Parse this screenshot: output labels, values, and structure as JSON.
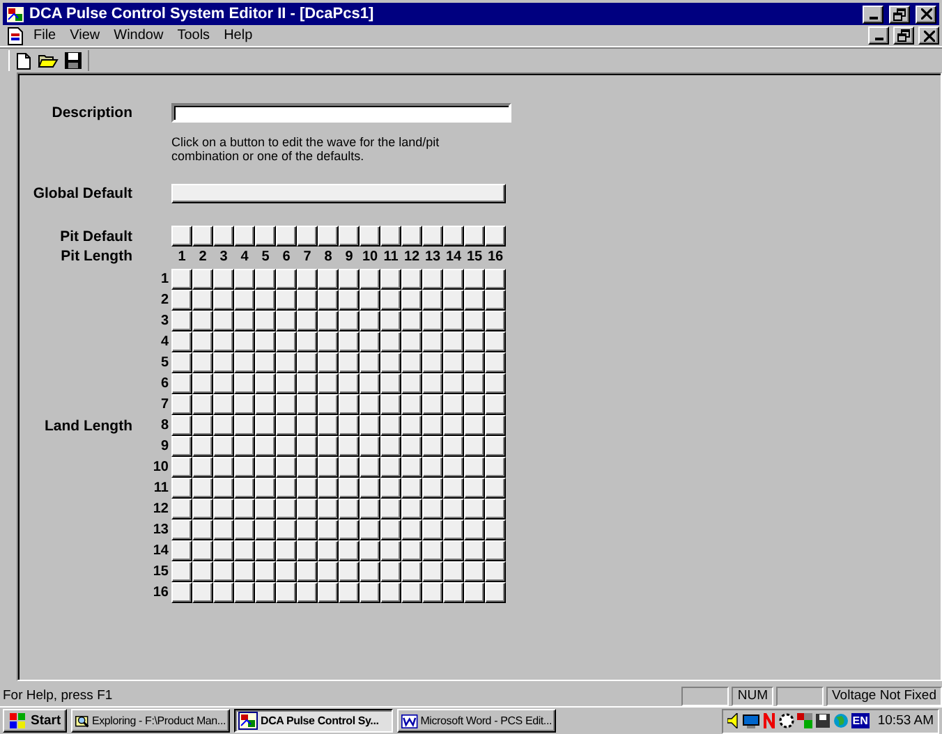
{
  "window": {
    "title": "DCA Pulse Control System Editor II - [DcaPcs1]"
  },
  "menu": [
    {
      "label": "File"
    },
    {
      "label": "View"
    },
    {
      "label": "Window"
    },
    {
      "label": "Tools"
    },
    {
      "label": "Help"
    }
  ],
  "form": {
    "description_label": "Description",
    "hint": "Click on a button to edit the wave for the land/pit combination or one of the defaults.",
    "global_default_label": "Global Default",
    "pit_default_label": "Pit Default",
    "pit_length_label": "Pit Length",
    "pit_lengths": [
      "1",
      "2",
      "3",
      "4",
      "5",
      "6",
      "7",
      "8",
      "9",
      "10",
      "11",
      "12",
      "13",
      "14",
      "15",
      "16"
    ],
    "land_length_label": "Land Length",
    "land_lengths": [
      "1",
      "2",
      "3",
      "4",
      "5",
      "6",
      "7",
      "8",
      "9",
      "10",
      "11",
      "12",
      "13",
      "14",
      "15",
      "16"
    ]
  },
  "status_bar": {
    "help": "For Help, press F1",
    "panes": [
      "NUM",
      "Voltage Not Fixed"
    ]
  },
  "taskbar": {
    "start": "Start",
    "tasks": [
      {
        "label": "Exploring - F:\\Product Man...",
        "selected": false
      },
      {
        "label": "DCA Pulse Control Sy...",
        "selected": true
      },
      {
        "label": "Microsoft Word - PCS Edit...",
        "selected": false
      }
    ],
    "language": "EN",
    "clock": "10:53 AM"
  }
}
